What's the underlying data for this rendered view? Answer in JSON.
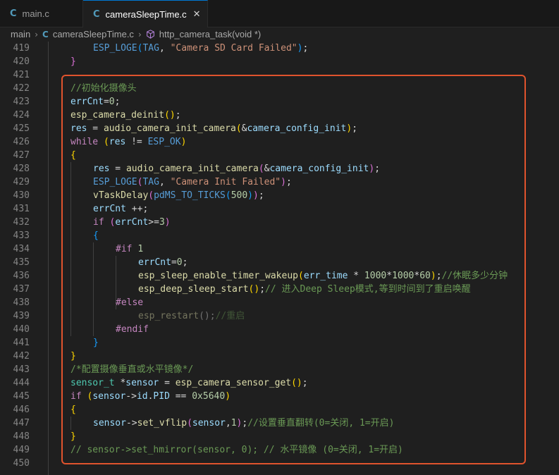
{
  "tabs": [
    {
      "label": "main.c",
      "active": false
    },
    {
      "label": "cameraSleepTime.c",
      "active": true
    }
  ],
  "breadcrumb": {
    "folder": "main",
    "file": "cameraSleepTime.c",
    "symbol": "http_camera_task(void *)"
  },
  "lines": [
    {
      "n": "419",
      "code": "ESP_LOGE(TAG, \"Camera SD Card Failed\");"
    },
    {
      "n": "420",
      "code": "}"
    },
    {
      "n": "421",
      "code": ""
    },
    {
      "n": "422",
      "code": "//初始化摄像头"
    },
    {
      "n": "423",
      "code": "errCnt=0;"
    },
    {
      "n": "424",
      "code": "esp_camera_deinit();"
    },
    {
      "n": "425",
      "code": "res = audio_camera_init_camera(&camera_config_init);"
    },
    {
      "n": "426",
      "code": "while (res != ESP_OK)"
    },
    {
      "n": "427",
      "code": "{"
    },
    {
      "n": "428",
      "code": "res = audio_camera_init_camera(&camera_config_init);"
    },
    {
      "n": "429",
      "code": "ESP_LOGE(TAG, \"Camera Init Failed\");"
    },
    {
      "n": "430",
      "code": "vTaskDelay(pdMS_TO_TICKS(500));"
    },
    {
      "n": "431",
      "code": "errCnt ++;"
    },
    {
      "n": "432",
      "code": "if (errCnt>=3)"
    },
    {
      "n": "433",
      "code": "{"
    },
    {
      "n": "434",
      "code": "#if 1"
    },
    {
      "n": "435",
      "code": "errCnt=0;"
    },
    {
      "n": "436",
      "code": "esp_sleep_enable_timer_wakeup(err_time * 1000*1000*60);//休眠多少分钟"
    },
    {
      "n": "437",
      "code": "esp_deep_sleep_start();// 进入Deep Sleep模式,等到时间到了重启唤醒"
    },
    {
      "n": "438",
      "code": "#else"
    },
    {
      "n": "439",
      "code": "esp_restart();//重启"
    },
    {
      "n": "440",
      "code": "#endif"
    },
    {
      "n": "441",
      "code": "}"
    },
    {
      "n": "442",
      "code": "}"
    },
    {
      "n": "443",
      "code": "/*配置摄像垂直或水平镜像*/"
    },
    {
      "n": "444",
      "code": "sensor_t *sensor = esp_camera_sensor_get();"
    },
    {
      "n": "445",
      "code": "if (sensor->id.PID == 0x5640)"
    },
    {
      "n": "446",
      "code": "{"
    },
    {
      "n": "447",
      "code": "sensor->set_vflip(sensor,1);//设置垂直翻转(0=关闭, 1=开启)"
    },
    {
      "n": "448",
      "code": "}"
    },
    {
      "n": "449",
      "code": "// sensor->set_hmirror(sensor, 0); // 水平镜像 (0=关闭, 1=开启)"
    },
    {
      "n": "450",
      "code": ""
    }
  ],
  "colors": {
    "highlight_border": "#e0532d",
    "active_tab_accent": "#0078d4"
  }
}
